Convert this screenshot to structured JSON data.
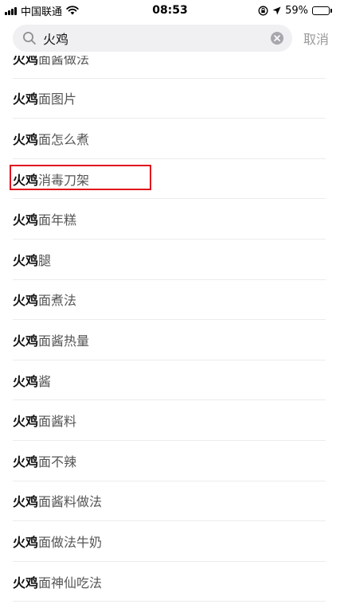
{
  "status_bar": {
    "carrier": "中国联通",
    "time": "08:53",
    "battery_percent": "59%",
    "battery_level": 0.59,
    "icons": [
      "signal-icon",
      "wifi-icon",
      "lock-rotation-icon",
      "location-icon",
      "battery-icon"
    ]
  },
  "search": {
    "query": "火鸡",
    "cancel_label": "取消"
  },
  "suggestions": [
    {
      "keyword": "火鸡",
      "suffix": "面酱做法"
    },
    {
      "keyword": "火鸡",
      "suffix": "面图片"
    },
    {
      "keyword": "火鸡",
      "suffix": "面怎么煮"
    },
    {
      "keyword": "火鸡",
      "suffix": "消毒刀架"
    },
    {
      "keyword": "火鸡",
      "suffix": "面年糕"
    },
    {
      "keyword": "火鸡",
      "suffix": "腿"
    },
    {
      "keyword": "火鸡",
      "suffix": "面煮法"
    },
    {
      "keyword": "火鸡",
      "suffix": "面酱热量"
    },
    {
      "keyword": "火鸡",
      "suffix": "酱"
    },
    {
      "keyword": "火鸡",
      "suffix": "面酱料"
    },
    {
      "keyword": "火鸡",
      "suffix": "面不辣"
    },
    {
      "keyword": "火鸡",
      "suffix": "面酱料做法"
    },
    {
      "keyword": "火鸡",
      "suffix": "面做法牛奶"
    },
    {
      "keyword": "火鸡",
      "suffix": "面神仙吃法"
    }
  ],
  "highlighted_index": 3,
  "colors": {
    "highlight_border": "#e0141e",
    "search_bg": "#f0f0f2",
    "cancel_text": "#9a9a9a"
  }
}
